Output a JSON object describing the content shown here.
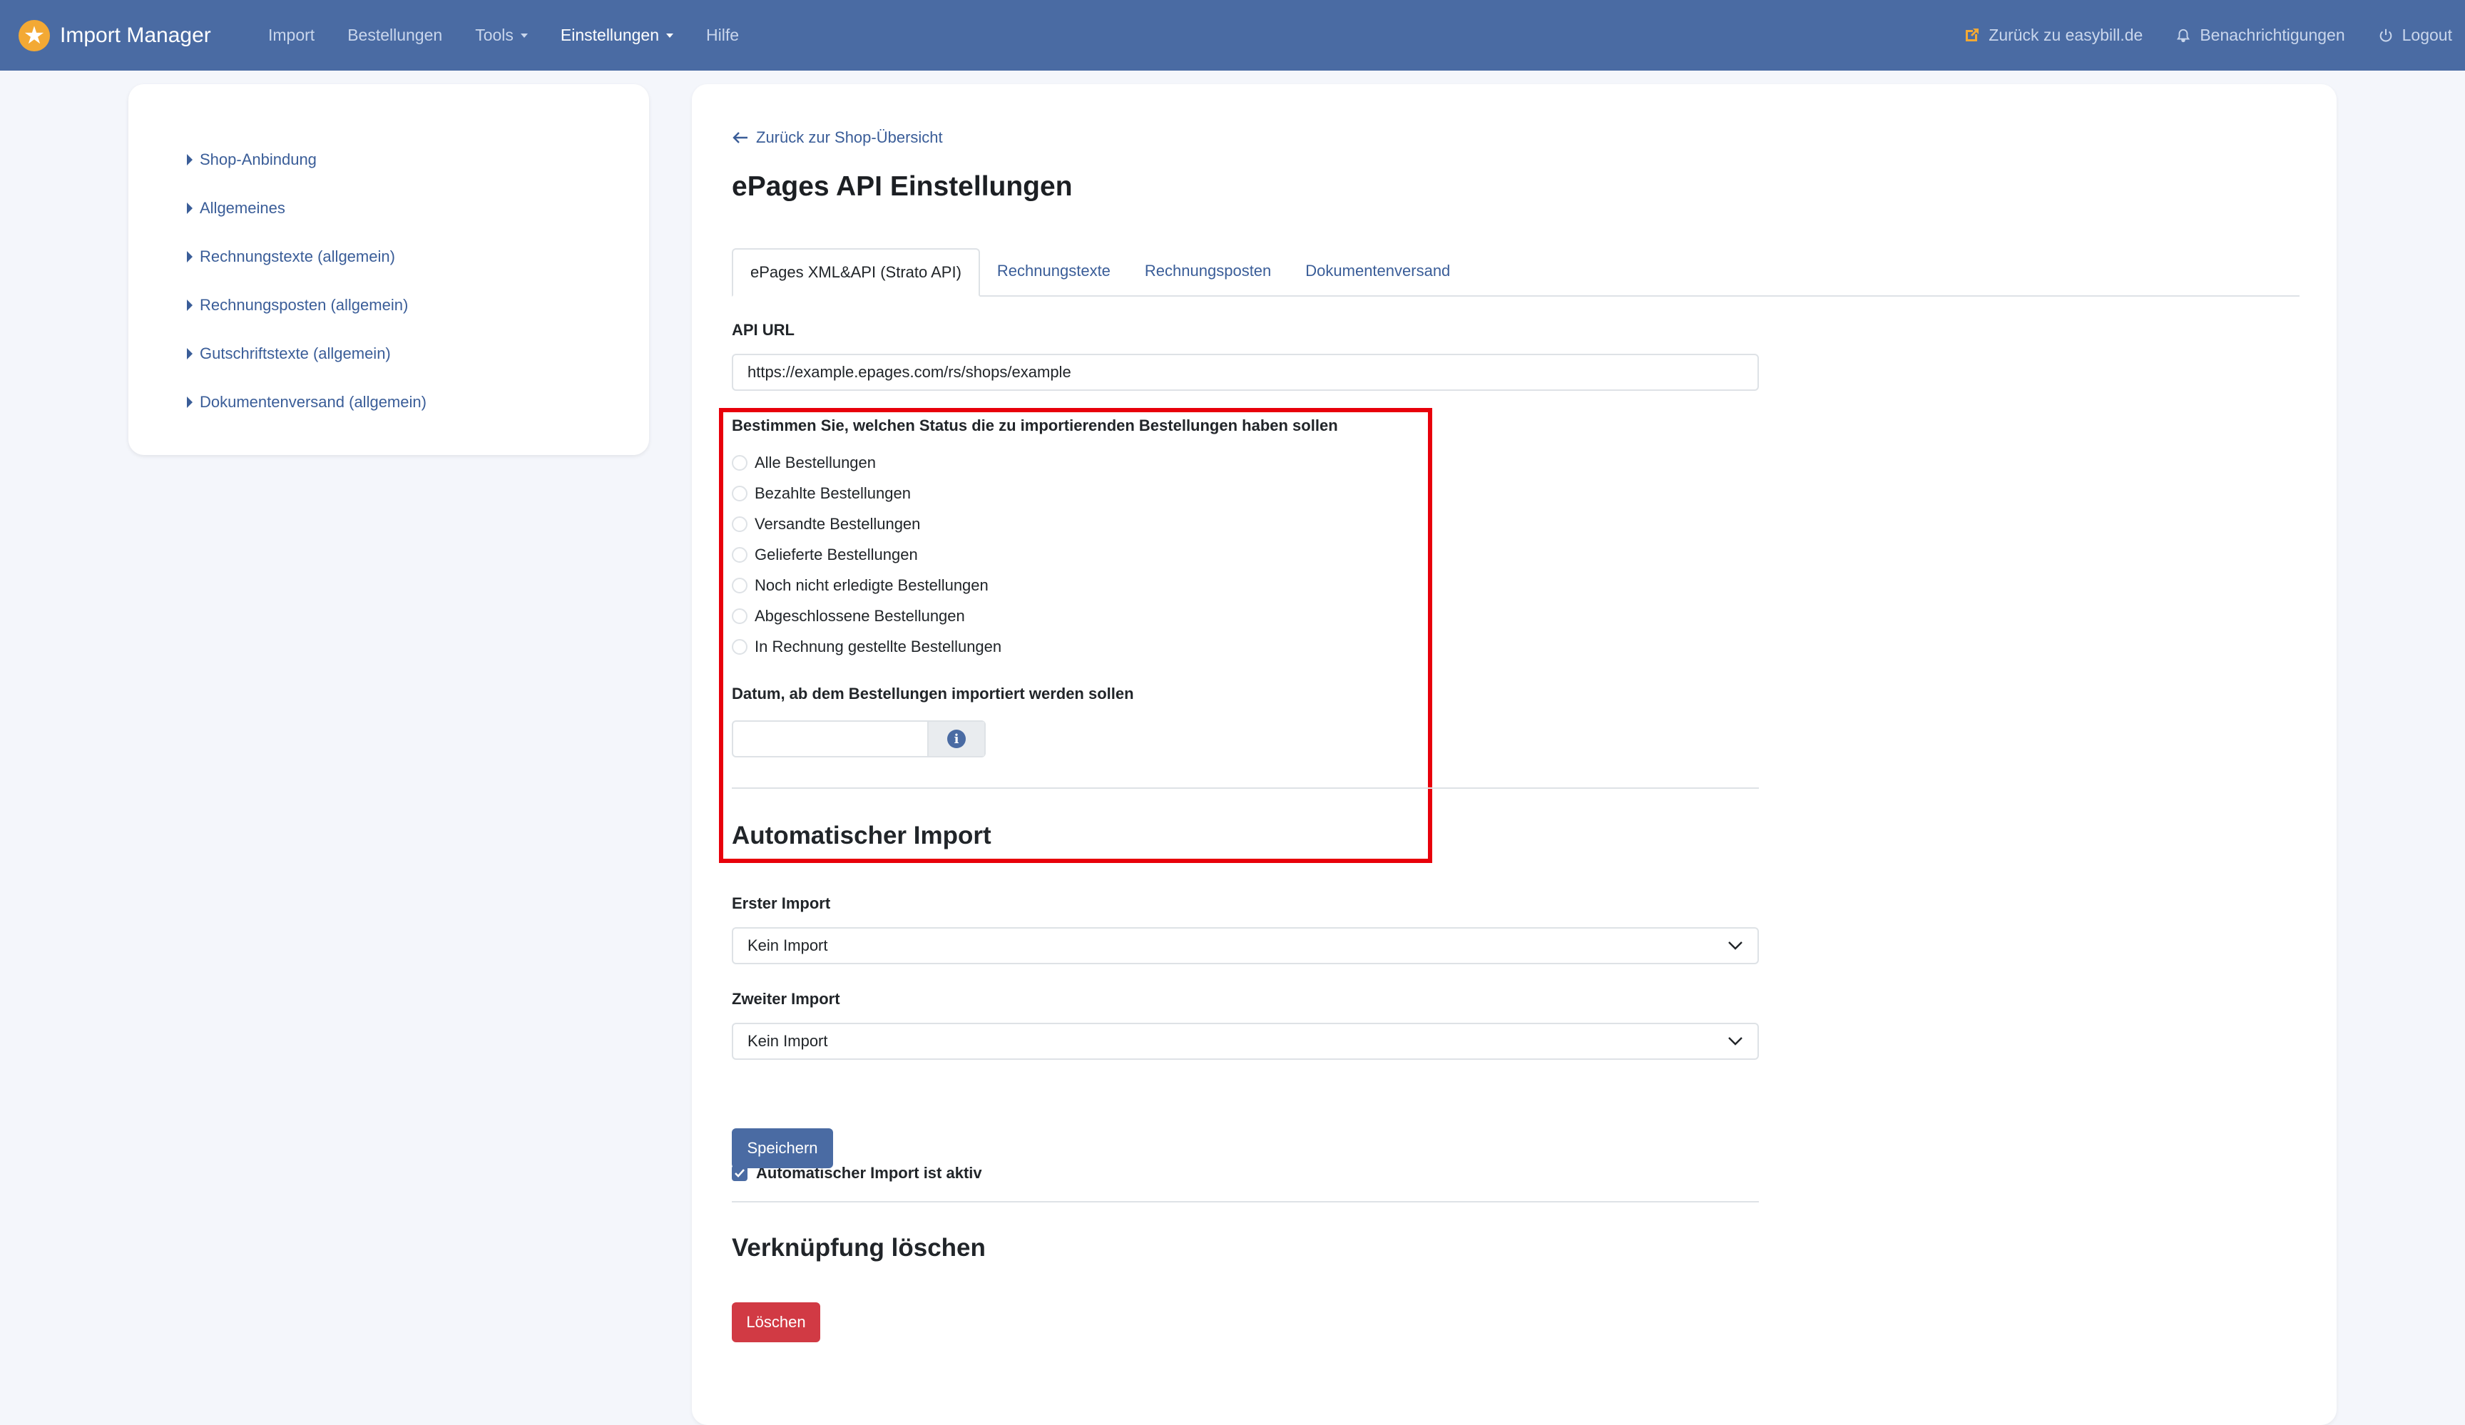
{
  "navbar": {
    "brand": "Import Manager",
    "links": [
      "Import",
      "Bestellungen",
      "Tools",
      "Einstellungen",
      "Hilfe"
    ],
    "back_easybill": "Zurück zu easybill.de",
    "notifications": "Benachrichtigungen",
    "logout": "Logout"
  },
  "sidebar": {
    "items": [
      {
        "label": "Shop-Anbindung"
      },
      {
        "label": "Allgemeines"
      },
      {
        "label": "Rechnungstexte (allgemein)"
      },
      {
        "label": "Rechnungsposten (allgemein)"
      },
      {
        "label": "Gutschriftstexte (allgemein)"
      },
      {
        "label": "Dokumentenversand (allgemein)"
      }
    ]
  },
  "main": {
    "back_link": "Zurück zur Shop-Übersicht",
    "title": "ePages API Einstellungen",
    "tabs": [
      {
        "label": "ePages XML&API (Strato API)"
      },
      {
        "label": "Rechnungstexte"
      },
      {
        "label": "Rechnungsposten"
      },
      {
        "label": "Dokumentenversand"
      }
    ],
    "api_url_label": "API URL",
    "api_url_value": "https://example.epages.com/rs/shops/example",
    "status_label": "Bestimmen Sie, welchen Status die zu importierenden Bestellungen haben sollen",
    "status_options": [
      "Alle Bestellungen",
      "Bezahlte Bestellungen",
      "Versandte Bestellungen",
      "Gelieferte Bestellungen",
      "Noch nicht erledigte Bestellungen",
      "Abgeschlossene Bestellungen",
      "In Rechnung gestellte Bestellungen"
    ],
    "date_label": "Datum, ab dem Bestellungen importiert werden sollen",
    "date_value": "",
    "auto_import_heading": "Automatischer Import",
    "first_import_label": "Erster Import",
    "first_import_value": "Kein Import",
    "second_import_label": "Zweiter Import",
    "second_import_value": "Kein Import",
    "auto_import_active_label": "Automatischer Import ist aktiv",
    "auto_import_active": true,
    "save_button": "Speichern",
    "delete_heading": "Verknüpfung löschen",
    "delete_button": "Löschen"
  },
  "colors": {
    "navbar": "#4a6ba3",
    "brand_logo": "#f3a934",
    "link": "#3a5d98",
    "highlight": "#e8000b",
    "danger": "#d13a44"
  }
}
